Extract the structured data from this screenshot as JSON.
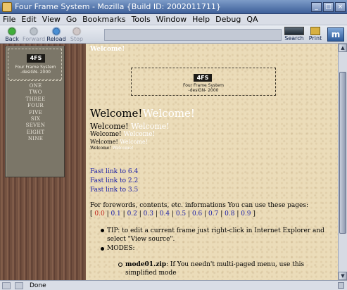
{
  "window": {
    "title": "Four Frame System - Mozilla {Build ID: 2002011711}",
    "controls": [
      "_",
      "□",
      "×"
    ]
  },
  "menubar": [
    "File",
    "Edit",
    "View",
    "Go",
    "Bookmarks",
    "Tools",
    "Window",
    "Help",
    "Debug",
    "QA"
  ],
  "toolbar": {
    "back": "Back",
    "forward": "Forward",
    "reload": "Reload",
    "stop": "Stop",
    "search": "Search",
    "print": "Print",
    "throbber": "m"
  },
  "sidebar_menu": {
    "logo_badge": "4FS",
    "logo_line1": "Four Frame System",
    "logo_line2": "-desiGN- 2000",
    "items": [
      "ONE",
      "TWO",
      "THREE",
      "FOUR",
      "FIVE",
      "SIX",
      "SEVEN",
      "EIGHT",
      "NINE"
    ]
  },
  "main": {
    "page_label": "Welcome!",
    "banner_badge": "4FS",
    "banner_line1": "Four Frame System",
    "banner_line2": "-desiGN- 2000",
    "welcome": "Welcome!",
    "fast_links": [
      "Fast link to 6.4",
      "Fast link to 2.2",
      "Fast link to 3.5"
    ],
    "info_text": "For forewords, contents, etc. informations You can use these pages:",
    "versions": [
      "0.0",
      "0.1",
      "0.2",
      "0.3",
      "0.4",
      "0.5",
      "0.6",
      "0.7",
      "0.8",
      "0.9"
    ],
    "active_version": "0.0",
    "tip": "TIP: to edit a current frame just right-click in Internet Explorer and select \"View source\".",
    "modes_label": "MODES:",
    "mode1_name": "mode01.zip",
    "mode1_desc": ": If You needn't multi-paged menu, use this simplified mode"
  },
  "statusbar": {
    "text": "Done"
  },
  "colors": {
    "link": "#1d21a8",
    "active_version": "#c0281e",
    "page_background": "#ebdcb9"
  }
}
